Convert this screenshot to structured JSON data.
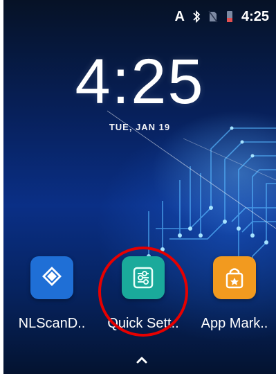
{
  "status_bar": {
    "letter": "A",
    "bluetooth_icon": "bluetooth-icon",
    "no_sim_icon": "no-sim-icon",
    "battery_icon": "battery-icon",
    "time": "4:25"
  },
  "lockscreen": {
    "clock": "4:25",
    "date": "TUE, JAN 19"
  },
  "apps": [
    {
      "label": "NLScanD..",
      "icon": "nlscan-icon",
      "color": "#1f6fd6"
    },
    {
      "label": "Quick Sett..",
      "icon": "quick-settings-icon",
      "color": "#1aaa9b"
    },
    {
      "label": "App Mark..",
      "icon": "shopping-bag-icon",
      "color": "#f29a1f"
    }
  ],
  "nav": {
    "up_icon": "chevron-up-icon"
  },
  "colors": {
    "highlight": "#e60000"
  }
}
